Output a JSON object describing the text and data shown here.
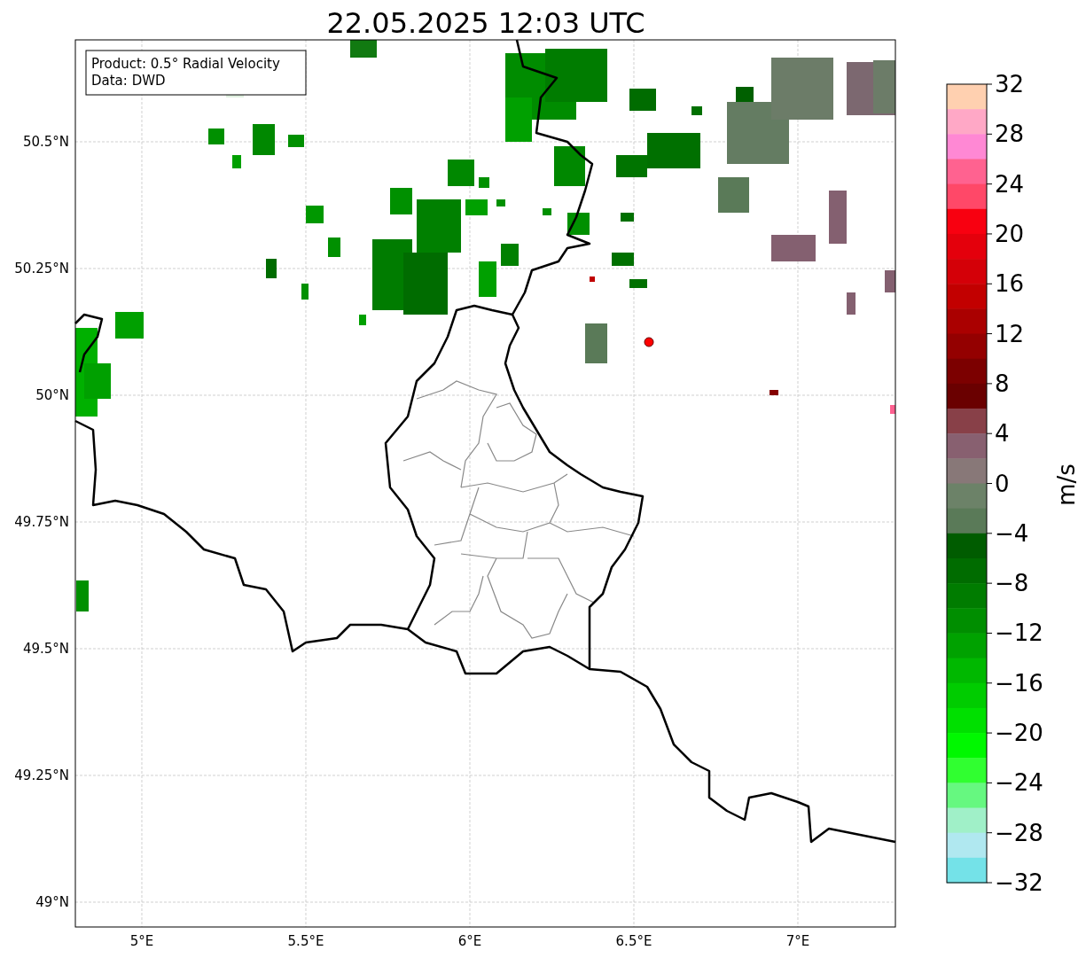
{
  "title": "22.05.2025 12:03 UTC",
  "legend": [
    "Product: 0.5° Radial Velocity",
    "Data: DWD"
  ],
  "map": {
    "x_ticks": [
      "5°E",
      "5.5°E",
      "6°E",
      "6.5°E",
      "7°E"
    ],
    "y_ticks": [
      "50.5°N",
      "50.25°N",
      "50°N",
      "49.75°N",
      "49.5°N",
      "49.25°N",
      "49°N"
    ]
  },
  "colorbar": {
    "label": "m/s",
    "ticks": [
      "32",
      "28",
      "24",
      "20",
      "16",
      "12",
      "8",
      "4",
      "0",
      "−4",
      "−8",
      "−12",
      "−16",
      "−20",
      "−24",
      "−28",
      "−32"
    ],
    "segments": [
      {
        "color": "#ffd0b0"
      },
      {
        "color": "#ffa8c6"
      },
      {
        "color": "#ff88d4"
      },
      {
        "color": "#ff6290"
      },
      {
        "color": "#ff4868"
      },
      {
        "color": "#f80010"
      },
      {
        "color": "#e4000c"
      },
      {
        "color": "#d40008"
      },
      {
        "color": "#c20000"
      },
      {
        "color": "#aa0000"
      },
      {
        "color": "#940000"
      },
      {
        "color": "#7c0000"
      },
      {
        "color": "#6a0000"
      },
      {
        "color": "#884048"
      },
      {
        "color": "#886070"
      },
      {
        "color": "#887878"
      },
      {
        "color": "#6c8268"
      },
      {
        "color": "#5a7a58"
      },
      {
        "color": "#005c00"
      },
      {
        "color": "#006c00"
      },
      {
        "color": "#007c00"
      },
      {
        "color": "#008e00"
      },
      {
        "color": "#00a200"
      },
      {
        "color": "#00b800"
      },
      {
        "color": "#00cc00"
      },
      {
        "color": "#00e000"
      },
      {
        "color": "#00f800"
      },
      {
        "color": "#30ff30"
      },
      {
        "color": "#66f880"
      },
      {
        "color": "#a0f0c8"
      },
      {
        "color": "#b0e8f0"
      },
      {
        "color": "#74e2e8"
      }
    ]
  }
}
